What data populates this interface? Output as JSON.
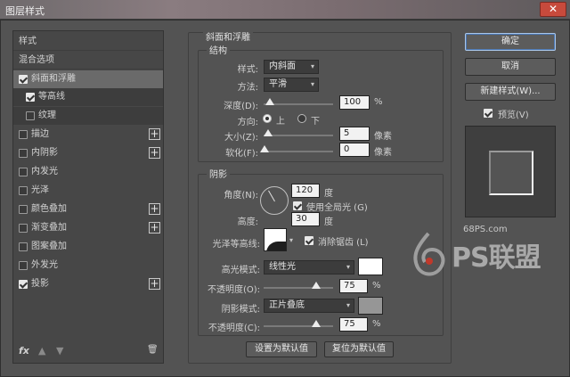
{
  "window": {
    "title": "图层样式",
    "close": "✕"
  },
  "stylelist": {
    "header": "样式",
    "blend_options": "混合选项",
    "items": [
      {
        "label": "斜面和浮雕",
        "checked": true
      },
      {
        "label": "等高线",
        "checked": true
      },
      {
        "label": "纹理",
        "checked": false
      },
      {
        "label": "描边",
        "checked": false
      },
      {
        "label": "内阴影",
        "checked": false
      },
      {
        "label": "内发光",
        "checked": false
      },
      {
        "label": "光泽",
        "checked": false
      },
      {
        "label": "颜色叠加",
        "checked": false
      },
      {
        "label": "渐变叠加",
        "checked": false
      },
      {
        "label": "图案叠加",
        "checked": false
      },
      {
        "label": "外发光",
        "checked": false
      },
      {
        "label": "投影",
        "checked": true
      }
    ],
    "plus": "+",
    "fx": "fx",
    "up": "▲",
    "down": "▼",
    "trash": "🗑"
  },
  "bevel": {
    "title": "斜面和浮雕",
    "structure_title": "结构",
    "style_label": "样式:",
    "style_value": "内斜面",
    "method_label": "方法:",
    "method_value": "平滑",
    "depth_label": "深度(D):",
    "depth_value": "100",
    "depth_unit": "%",
    "direction_label": "方向:",
    "dir_up": "上",
    "dir_down": "下",
    "size_label": "大小(Z):",
    "size_value": "5",
    "size_unit": "像素",
    "soften_label": "软化(F):",
    "soften_value": "0",
    "soften_unit": "像素"
  },
  "shading": {
    "title": "阴影",
    "angle_label": "角度(N):",
    "angle_value": "120",
    "angle_unit": "度",
    "global_light": "使用全局光 (G)",
    "altitude_label": "高度:",
    "altitude_value": "30",
    "altitude_unit": "度",
    "gloss_label": "光泽等高线:",
    "anti_alias": "消除锯齿 (L)",
    "highlight_mode_label": "高光模式:",
    "highlight_mode": "线性光",
    "highlight_opacity_label": "不透明度(O):",
    "highlight_opacity": "75",
    "shadow_mode_label": "阴影模式:",
    "shadow_mode": "正片叠底",
    "shadow_opacity_label": "不透明度(C):",
    "shadow_opacity": "75",
    "pct": "%"
  },
  "bottom_buttons": {
    "make_default": "设置为默认值",
    "reset_default": "复位为默认值"
  },
  "right": {
    "ok": "确定",
    "cancel": "取消",
    "new_style": "新建样式(W)...",
    "preview": "预览(V)"
  },
  "watermark": {
    "site": "68PS.com",
    "brand": "PS联盟"
  }
}
